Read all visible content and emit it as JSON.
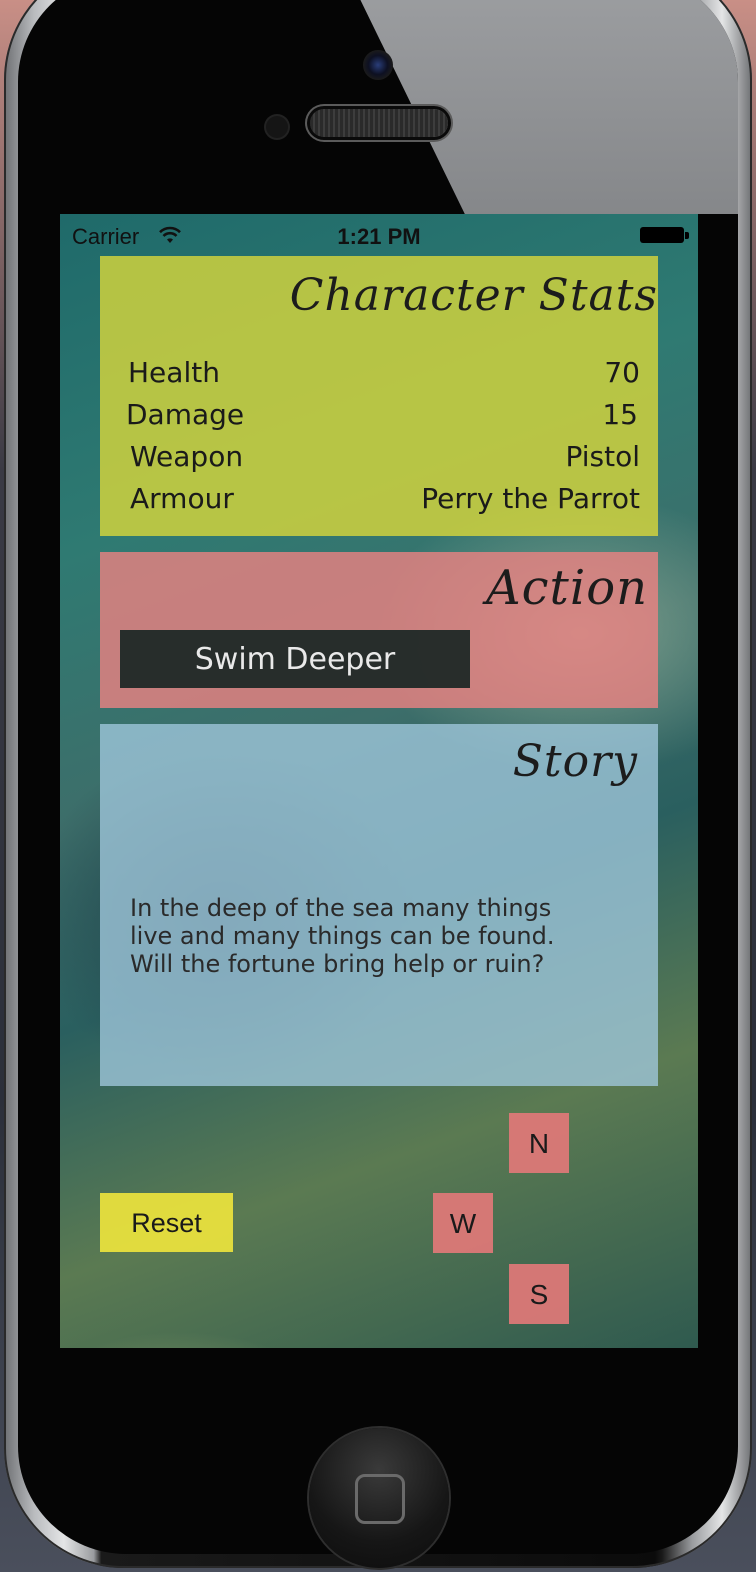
{
  "status_bar": {
    "carrier": "Carrier",
    "time": "1:21 PM",
    "wifi_icon": "wifi-icon",
    "battery_icon": "battery-icon"
  },
  "character_stats": {
    "title": "Character Stats",
    "rows": [
      {
        "label": "Health",
        "value": "70"
      },
      {
        "label": "Damage",
        "value": "15"
      },
      {
        "label": "Weapon",
        "value": "Pistol"
      },
      {
        "label": "Armour",
        "value": "Perry the Parrot"
      }
    ]
  },
  "action": {
    "title": "Action",
    "button_label": "Swim Deeper"
  },
  "story": {
    "title": "Story",
    "text_lines": [
      "In the deep of the sea many things",
      "live and many things can be found.",
      "Will the fortune bring help or ruin?"
    ]
  },
  "controls": {
    "reset_label": "Reset",
    "north_label": "N",
    "west_label": "W",
    "south_label": "S"
  },
  "colors": {
    "stats_panel": "#d6d63c",
    "action_panel": "#ec8282",
    "story_panel": "#a0c8dc",
    "reset_button": "#f0e63c",
    "direction_button": "#e17878"
  }
}
